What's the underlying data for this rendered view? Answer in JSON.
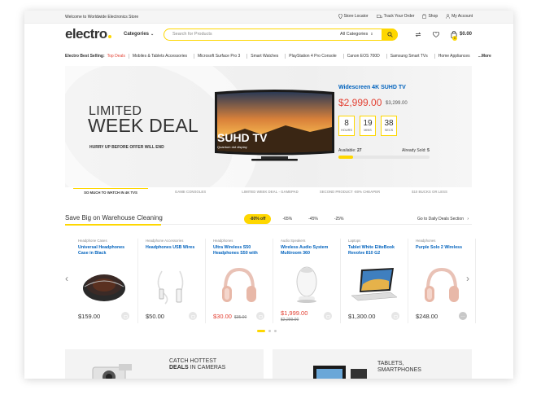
{
  "topbar": {
    "welcome": "Welcome to Worldwide Electronics Store",
    "links": [
      "Store Locator",
      "Track Your Order",
      "Shop",
      "My Account"
    ]
  },
  "header": {
    "logo": "electro",
    "categories_label": "Categories",
    "search_placeholder": "Search for Products",
    "search_category": "All Categories",
    "cart_total": "$0.00",
    "cart_count": "0"
  },
  "nav": {
    "label": "Electro Best Selling:",
    "highlight": "Top Deals",
    "items": [
      "Mobiles & Tablets Accessories",
      "Microsoft Surface Pro 3",
      "Smart Watches",
      "PlayStation 4 Pro Console",
      "Canon EOS 700D",
      "Samsung Smart TVs",
      "Home Appliances"
    ],
    "more": "...More"
  },
  "hero": {
    "line1": "LIMITED",
    "line2": "WEEK DEAL",
    "subtitle": "HURRY UP BEFORE OFFER WILL END",
    "tv_text": "SUHD TV",
    "tv_subtext": "Quantum dot display",
    "deal_title": "Widescreen 4K SUHD TV",
    "deal_price": "$2,999.00",
    "deal_old_price": "$3,299.00",
    "timer": [
      {
        "value": "8",
        "unit": "HOURS"
      },
      {
        "value": "19",
        "unit": "MINS"
      },
      {
        "value": "38",
        "unit": "SECS"
      }
    ],
    "available_label": "Available:",
    "available_value": "27",
    "sold_label": "Already Sold:",
    "sold_value": "5",
    "sold_fraction": 0.16
  },
  "slider_tabs": [
    "SO MUCH TO WATCH IN 4K TVS",
    "GAME CONSOLES",
    "LIMITED WEEK DEAL - GAMEPAD",
    "SECOND PRODUCT -80% CHEAPER",
    "$10 BUCKS OR LESS"
  ],
  "section": {
    "title": "Save Big on Warehouse Cleaning",
    "filters": [
      "-80% off",
      "-65%",
      "-45%",
      "-25%"
    ],
    "daily_link": "Go to Daily Deals Section"
  },
  "products": [
    {
      "category": "Headphone Cases",
      "name": "Universal Headphones Case in Black",
      "price": "$159.00",
      "old": "",
      "sale": false
    },
    {
      "category": "Headphone Accessories",
      "name": "Headphones USB Wires",
      "price": "$50.00",
      "old": "",
      "sale": false
    },
    {
      "category": "Headphones",
      "name": "Ultra Wireless S50 Headphones S50 with",
      "price": "$30.00",
      "old": "$35.00",
      "sale": true
    },
    {
      "category": "Audio Speakers",
      "name": "Wireless Audio System Multiroom 360",
      "price": "$1,999.00",
      "old": "$2,299.00",
      "sale": true
    },
    {
      "category": "Laptops",
      "name": "Tablet White EliteBook Revolve 810 G2",
      "price": "$1,300.00",
      "old": "",
      "sale": false
    },
    {
      "category": "Headphones",
      "name": "Purple Solo 2 Wireless",
      "price": "$248.00",
      "old": "",
      "sale": false
    }
  ],
  "banners": {
    "b1_line1": "CATCH HOTTEST",
    "b1_bold": "DEALS",
    "b1_rest": "IN CAMERAS",
    "b2_line1": "TABLETS,",
    "b2_line2": "SMARTPHONES"
  },
  "colors": {
    "accent": "#fed700",
    "link": "#0062bd",
    "sale": "#e34234"
  }
}
